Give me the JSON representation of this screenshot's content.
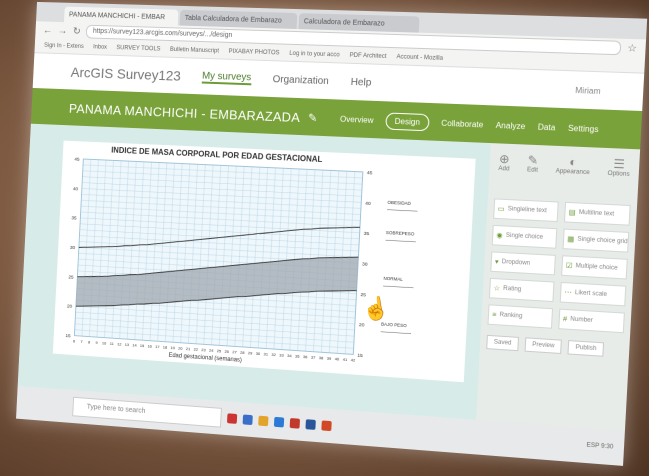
{
  "browser": {
    "tabs": [
      "PANAMA MANCHICHI - EMBAR",
      "Tabla Calculadora de Embarazo",
      "Calculadora de Embarazo"
    ],
    "url": "https://survey123.arcgis.com/surveys/.../design",
    "bookmarks": [
      "Sign In - Extens",
      "Inbox",
      "SURVEY TOOLS",
      "Bulletin Manuscript",
      "PIXABAY PHOTOS",
      "Log in to your acco",
      "PDF Architect",
      "Account - Mozilla"
    ]
  },
  "app": {
    "title": "ArcGIS Survey123",
    "nav": [
      "My surveys",
      "Organization",
      "Help"
    ],
    "user": "Miriam"
  },
  "survey": {
    "title": "PANAMA MANCHICHI - EMBARAZADA",
    "nav": [
      "Overview",
      "Design",
      "Collaborate",
      "Analyze",
      "Data",
      "Settings"
    ]
  },
  "panel": {
    "tabs": [
      "Add",
      "Edit",
      "Appearance",
      "Options"
    ],
    "questions": [
      "Singleline text",
      "Multiline text",
      "Single choice",
      "Single choice grid",
      "Dropdown",
      "Multiple choice",
      "Rating",
      "Likert scale",
      "Ranking",
      "Number"
    ],
    "footer": [
      "Saved",
      "Preview",
      "Publish"
    ]
  },
  "taskbar": {
    "search_placeholder": "Type here to search",
    "tray": "ESP 9:30"
  },
  "chart_data": {
    "type": "area",
    "title": "INDICE DE MASA CORPORAL POR EDAD GESTACIONAL",
    "xlabel": "Edad gestacional (semanas)",
    "ylabel": "",
    "x": [
      6,
      7,
      8,
      9,
      10,
      11,
      12,
      13,
      14,
      15,
      16,
      17,
      18,
      19,
      20,
      21,
      22,
      23,
      24,
      25,
      26,
      27,
      28,
      29,
      30,
      31,
      32,
      33,
      34,
      35,
      36,
      37,
      38,
      39,
      40,
      41,
      42
    ],
    "ylim": [
      15,
      45
    ],
    "yticks": [
      15,
      20,
      25,
      30,
      35,
      40,
      45
    ],
    "series": [
      {
        "name": "BAJO PESO",
        "values": [
          20,
          20.1,
          20.2,
          20.3,
          20.4,
          20.5,
          20.7,
          20.8,
          21,
          21.1,
          21.3,
          21.4,
          21.6,
          21.8,
          22,
          22.2,
          22.3,
          22.5,
          22.7,
          22.9,
          23.1,
          23.3,
          23.4,
          23.6,
          23.8,
          24,
          24.2,
          24.3,
          24.5,
          24.7,
          24.8,
          25,
          25.1,
          25.2,
          25.3,
          25.4,
          25.5
        ]
      },
      {
        "name": "NORMAL",
        "values": [
          25,
          25.1,
          25.2,
          25.3,
          25.4,
          25.6,
          25.7,
          25.9,
          26,
          26.2,
          26.4,
          26.6,
          26.8,
          27,
          27.2,
          27.4,
          27.6,
          27.8,
          28,
          28.2,
          28.4,
          28.6,
          28.8,
          29,
          29.2,
          29.4,
          29.6,
          29.8,
          30,
          30.2,
          30.3,
          30.5,
          30.6,
          30.7,
          30.8,
          30.9,
          31
        ]
      },
      {
        "name": "SOBREPESO",
        "values": [
          30,
          30.1,
          30.2,
          30.3,
          30.4,
          30.5,
          30.7,
          30.8,
          31,
          31.1,
          31.3,
          31.5,
          31.7,
          31.9,
          32.1,
          32.3,
          32.5,
          32.7,
          32.9,
          33.1,
          33.3,
          33.5,
          33.7,
          33.9,
          34.1,
          34.3,
          34.5,
          34.7,
          34.9,
          35.1,
          35.2,
          35.4,
          35.5,
          35.6,
          35.7,
          35.8,
          35.9
        ]
      }
    ],
    "band_labels": [
      "OBESIDAD",
      "SOBREPESO",
      "NORMAL",
      "BAJO PESO"
    ]
  }
}
